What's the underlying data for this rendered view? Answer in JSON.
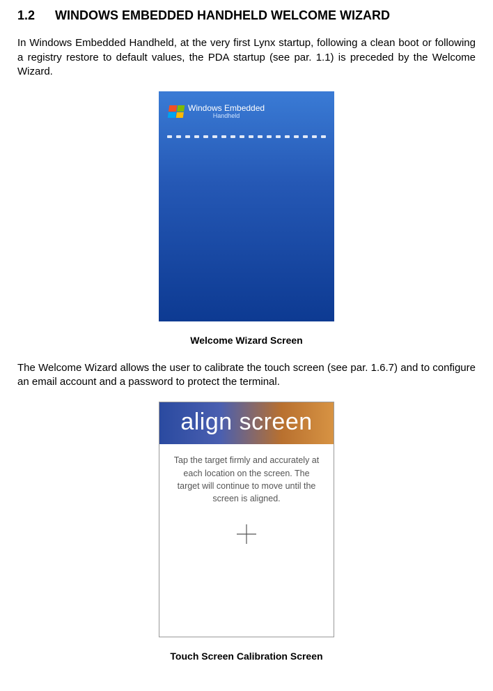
{
  "heading": {
    "number": "1.2",
    "title": "WINDOWS EMBEDDED HANDHELD WELCOME WIZARD"
  },
  "para1": "In Windows Embedded Handheld, at the very first Lynx startup, following a clean boot or following a registry restore to default values, the PDA startup (see par. 1.1) is preceded by the Welcome Wizard.",
  "screenshot1": {
    "brand_line1": "Windows Embedded",
    "brand_line2": "Handheld"
  },
  "caption1": "Welcome Wizard Screen",
  "para2": "The Welcome Wizard allows the user to calibrate the touch screen (see par. 1.6.7) and to configure an email account and a password to protect the terminal.",
  "screenshot2": {
    "header": "align screen",
    "body": "Tap the target firmly and accurately at each location on the screen. The target will continue to move until the screen is aligned."
  },
  "caption2": "Touch Screen Calibration Screen"
}
